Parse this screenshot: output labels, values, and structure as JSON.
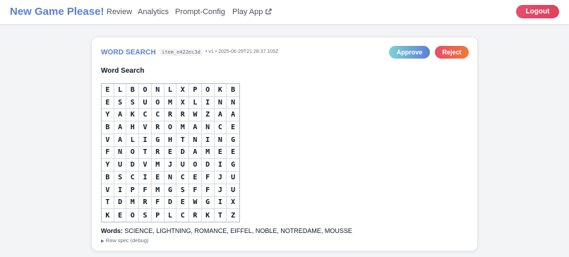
{
  "header": {
    "brand": "New Game Please!",
    "nav": {
      "review": "Review",
      "analytics": "Analytics",
      "prompt_config": "Prompt-Config",
      "play_app": "Play App"
    },
    "logout_label": "Logout"
  },
  "item": {
    "type_label": "WORD SEARCH",
    "id": "item_e422ec3d",
    "meta": "• v1 • 2025-06-29T21:28:37.105Z",
    "approve_label": "Approve",
    "reject_label": "Reject",
    "game_title": "Word Search",
    "grid": [
      [
        "E",
        "L",
        "B",
        "O",
        "N",
        "L",
        "X",
        "P",
        "O",
        "K",
        "B"
      ],
      [
        "E",
        "S",
        "S",
        "U",
        "O",
        "M",
        "X",
        "L",
        "I",
        "N",
        "N"
      ],
      [
        "Y",
        "A",
        "K",
        "C",
        "C",
        "R",
        "R",
        "W",
        "Z",
        "A",
        "A"
      ],
      [
        "B",
        "A",
        "H",
        "V",
        "R",
        "O",
        "M",
        "A",
        "N",
        "C",
        "E"
      ],
      [
        "V",
        "A",
        "L",
        "I",
        "G",
        "H",
        "T",
        "N",
        "I",
        "N",
        "G"
      ],
      [
        "F",
        "N",
        "O",
        "T",
        "R",
        "E",
        "D",
        "A",
        "M",
        "E",
        "E"
      ],
      [
        "Y",
        "U",
        "D",
        "V",
        "M",
        "J",
        "U",
        "O",
        "D",
        "I",
        "G"
      ],
      [
        "B",
        "S",
        "C",
        "I",
        "E",
        "N",
        "C",
        "E",
        "F",
        "J",
        "U"
      ],
      [
        "V",
        "I",
        "P",
        "F",
        "M",
        "G",
        "S",
        "F",
        "F",
        "J",
        "U"
      ],
      [
        "T",
        "D",
        "M",
        "R",
        "F",
        "D",
        "E",
        "W",
        "G",
        "I",
        "X"
      ],
      [
        "K",
        "E",
        "O",
        "S",
        "P",
        "L",
        "C",
        "R",
        "K",
        "T",
        "Z"
      ]
    ],
    "words_label": "Words:",
    "words": "SCIENCE, LIGHTNING, ROMANCE, EIFFEL, NOBLE, NOTREDAME, MOUSSE",
    "raw_spec_label": "Raw spec (debug)"
  },
  "icons": {
    "external_link": "external-link-icon",
    "disclosure": "triangle-right-icon"
  },
  "colors": {
    "brand": "#5b7fd8",
    "logout": "#e0405d",
    "approve_start": "#7dd3d3",
    "approve_end": "#5b7fd8",
    "reject_start": "#e64d6c",
    "reject_end": "#ef7a36"
  }
}
